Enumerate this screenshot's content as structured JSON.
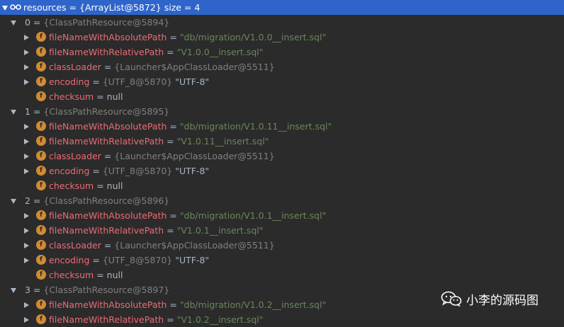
{
  "rows": [
    {
      "name": "resources",
      "eq": " = ",
      "ref": "{ArrayList@5872}",
      "extra": "  size = 4"
    },
    {
      "name": "0",
      "eq": " = ",
      "ref": "{ClassPathResource@5894}"
    },
    {
      "name": "fileNameWithAbsolutePath",
      "eq": " = ",
      "val": "\"db/migration/V1.0.0__insert.sql\""
    },
    {
      "name": "fileNameWithRelativePath",
      "eq": " = ",
      "val": "\"V1.0.0__insert.sql\""
    },
    {
      "name": "classLoader",
      "eq": " = ",
      "ref": "{Launcher$AppClassLoader@5511}"
    },
    {
      "name": "encoding",
      "eq": " = ",
      "ref": "{UTF_8@5870}",
      "extra": " \"UTF-8\""
    },
    {
      "name": "checksum",
      "eq": " = ",
      "extra": "null"
    },
    {
      "name": "1",
      "eq": " = ",
      "ref": "{ClassPathResource@5895}"
    },
    {
      "name": "fileNameWithAbsolutePath",
      "eq": " = ",
      "val": "\"db/migration/V1.0.11__insert.sql\""
    },
    {
      "name": "fileNameWithRelativePath",
      "eq": " = ",
      "val": "\"V1.0.11__insert.sql\""
    },
    {
      "name": "classLoader",
      "eq": " = ",
      "ref": "{Launcher$AppClassLoader@5511}"
    },
    {
      "name": "encoding",
      "eq": " = ",
      "ref": "{UTF_8@5870}",
      "extra": " \"UTF-8\""
    },
    {
      "name": "checksum",
      "eq": " = ",
      "extra": "null"
    },
    {
      "name": "2",
      "eq": " = ",
      "ref": "{ClassPathResource@5896}"
    },
    {
      "name": "fileNameWithAbsolutePath",
      "eq": " = ",
      "val": "\"db/migration/V1.0.1__insert.sql\""
    },
    {
      "name": "fileNameWithRelativePath",
      "eq": " = ",
      "val": "\"V1.0.1__insert.sql\""
    },
    {
      "name": "classLoader",
      "eq": " = ",
      "ref": "{Launcher$AppClassLoader@5511}"
    },
    {
      "name": "encoding",
      "eq": " = ",
      "ref": "{UTF_8@5870}",
      "extra": " \"UTF-8\""
    },
    {
      "name": "checksum",
      "eq": " = ",
      "extra": "null"
    },
    {
      "name": "3",
      "eq": " = ",
      "ref": "{ClassPathResource@5897}"
    },
    {
      "name": "fileNameWithAbsolutePath",
      "eq": " = ",
      "val": "\"db/migration/V1.0.2__insert.sql\""
    },
    {
      "name": "fileNameWithRelativePath",
      "eq": " = ",
      "val": "\"V1.0.2__insert.sql\""
    }
  ],
  "badge_letter": "f",
  "watermark": {
    "text": "小李的源码图"
  },
  "colors": {
    "background": "#2b2b2b",
    "selection": "#2f65ca",
    "field_name": "#ed6b74",
    "string_value": "#6a8759",
    "reference": "#808080",
    "field_badge": "#d18b34"
  }
}
